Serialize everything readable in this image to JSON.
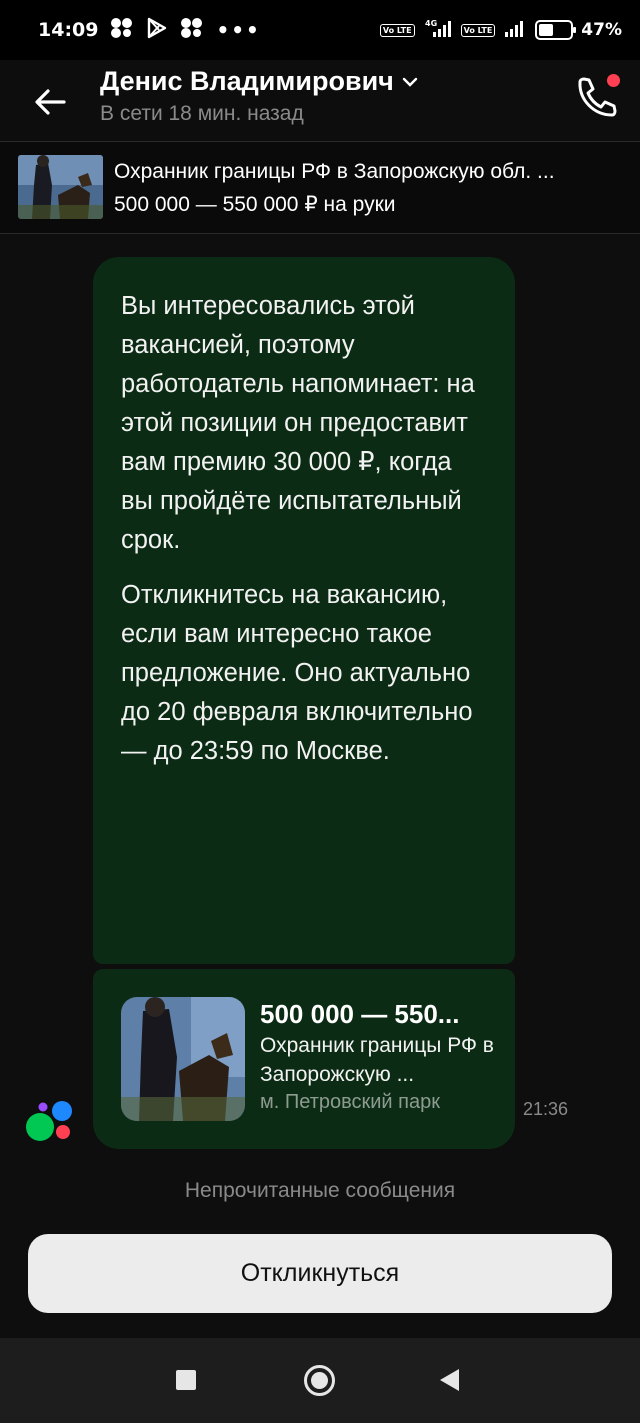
{
  "status_bar": {
    "time": "14:09",
    "dots": "•••",
    "network": "4G",
    "volte": "Vo LTE",
    "battery": "47%",
    "battery_level": 0.47
  },
  "header": {
    "contact_name": "Денис Владимирович",
    "status": "В сети 18 мин. назад"
  },
  "vacancy": {
    "title": "Охранник границы РФ в Запорожскую обл. ...",
    "salary": "500 000 — 550 000 ₽ на руки"
  },
  "message": {
    "paragraph_1": "Вы интересовались этой вакансией, поэтому работодатель напоминает: на этой позиции он предоставит вам премию 30 000 ₽, когда вы пройдёте испытательный срок.",
    "paragraph_2": "Откликнитесь на вакансию, если вам интересно такое предложение. Оно актуально до 20 февраля включительно — до 23:59 по Москве.",
    "time": "21:36"
  },
  "card": {
    "salary": "500 000 — 550...",
    "title": "Охранник границы РФ в Запорожскую ...",
    "metro": "м. Петровский парк"
  },
  "unread_label": "Непрочитанные сообщения",
  "respond_button": "Откликнуться",
  "colors": {
    "bubble": "#0b2b14",
    "accent_red": "#ff4053",
    "button": "#ececec"
  }
}
